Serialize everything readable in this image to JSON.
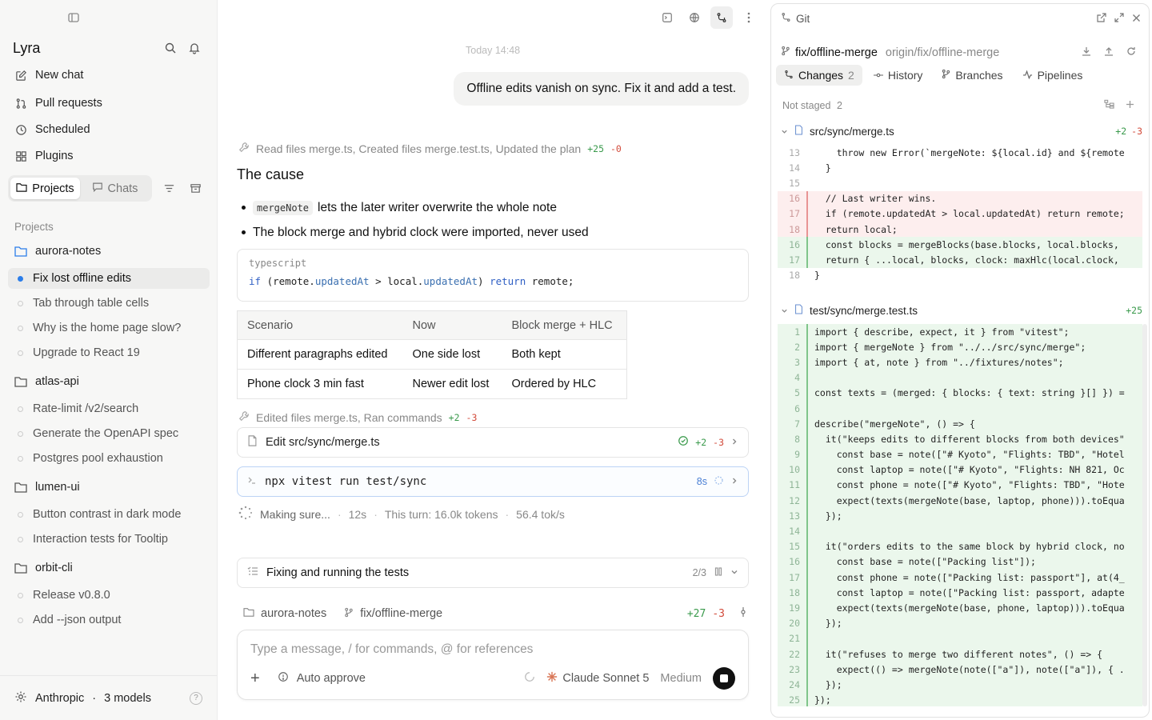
{
  "sidebar": {
    "brand": "Lyra",
    "nav": [
      {
        "label": "New chat",
        "icon": "compose-icon"
      },
      {
        "label": "Pull requests",
        "icon": "pull-request-icon"
      },
      {
        "label": "Scheduled",
        "icon": "clock-icon"
      },
      {
        "label": "Plugins",
        "icon": "plugins-icon"
      }
    ],
    "tabs": {
      "projects": "Projects",
      "chats": "Chats"
    },
    "section_label": "Projects",
    "projects": [
      {
        "name": "aurora-notes",
        "threads": [
          "Fix lost offline edits",
          "Tab through table cells",
          "Why is the home page slow?",
          "Upgrade to React 19"
        ]
      },
      {
        "name": "atlas-api",
        "threads": [
          "Rate-limit /v2/search",
          "Generate the OpenAPI spec",
          "Postgres pool exhaustion"
        ]
      },
      {
        "name": "lumen-ui",
        "threads": [
          "Button contrast in dark mode",
          "Interaction tests for Tooltip"
        ]
      },
      {
        "name": "orbit-cli",
        "threads": [
          "Release v0.8.0",
          "Add --json output"
        ]
      }
    ],
    "footer": {
      "provider": "Anthropic",
      "dot": "·",
      "models": "3 models",
      "help": "?"
    }
  },
  "chat": {
    "timestamp": "Today 14:48",
    "user_message": "Offline edits vanish on sync. Fix it and add a test.",
    "activity1": {
      "text": "Read files merge.ts, Created files merge.test.ts, Updated the plan",
      "add": "+25",
      "del": "-0"
    },
    "heading": "The cause",
    "bullet1": {
      "code": "mergeNote",
      "text": "lets the later writer overwrite the whole note"
    },
    "bullet2": "The block merge and hybrid clock were imported, never used",
    "code": {
      "lang": "typescript",
      "kw1": "if",
      "p1": "(remote.",
      "prop1": "updatedAt",
      "p2": " > local.",
      "prop2": "updatedAt",
      "p3": ") ",
      "kw2": "return",
      "p4": " remote;"
    },
    "table": {
      "headers": [
        "Scenario",
        "Now",
        "Block merge + HLC"
      ],
      "rows": [
        [
          "Different paragraphs edited",
          "One side lost",
          "Both kept"
        ],
        [
          "Phone clock 3 min fast",
          "Newer edit lost",
          "Ordered by HLC"
        ]
      ]
    },
    "activity2": {
      "text": "Edited files merge.ts, Ran commands",
      "add": "+2",
      "del": "-3"
    },
    "edit_card": {
      "label": "Edit src/sync/merge.ts",
      "add": "+2",
      "del": "-3"
    },
    "run_card": {
      "label": "npx vitest run test/sync",
      "time": "8s"
    },
    "status": {
      "label": "Making sure...",
      "elapsed": "12s",
      "turn": "This turn: 16.0k tokens",
      "rate": "56.4 tok/s",
      "sep": "·"
    },
    "plan": {
      "label": "Fixing and running the tests",
      "progress": "2/3"
    },
    "context": {
      "project": "aurora-notes",
      "branch": "fix/offline-merge",
      "add": "+27",
      "del": "-3"
    },
    "composer": {
      "placeholder": "Type a message, / for commands, @ for references",
      "auto": "Auto approve",
      "model": "Claude Sonnet 5",
      "effort": "Medium"
    }
  },
  "git": {
    "title": "Git",
    "branch": "fix/offline-merge",
    "remote": "origin/fix/offline-merge",
    "tabs": [
      {
        "label": "Changes",
        "count": "2"
      },
      {
        "label": "History",
        "count": ""
      },
      {
        "label": "Branches",
        "count": ""
      },
      {
        "label": "Pipelines",
        "count": ""
      }
    ],
    "not_staged": "Not staged",
    "not_staged_count": "2",
    "file1": {
      "path": "src/sync/merge.ts",
      "add": "+2",
      "del": "-3"
    },
    "file2": {
      "path": "test/sync/merge.test.ts",
      "add": "+25"
    },
    "diff1": [
      {
        "n": "13",
        "t": "ctx",
        "code": "    throw new Error(`mergeNote: ${local.id} and ${remote"
      },
      {
        "n": "14",
        "t": "ctx",
        "code": "  }"
      },
      {
        "n": "15",
        "t": "ctx",
        "code": ""
      },
      {
        "n": "16",
        "t": "rm",
        "code": "  // Last writer wins."
      },
      {
        "n": "17",
        "t": "rm",
        "code": "  if (remote.updatedAt > local.updatedAt) return remote;"
      },
      {
        "n": "18",
        "t": "rm",
        "code": "  return local;"
      },
      {
        "n": "16",
        "t": "ad",
        "code": "  const blocks = mergeBlocks(base.blocks, local.blocks,"
      },
      {
        "n": "17",
        "t": "ad",
        "code": "  return { ...local, blocks, clock: maxHlc(local.clock,"
      },
      {
        "n": "18",
        "t": "ctx",
        "code": "}"
      }
    ],
    "diff2": [
      {
        "n": "1",
        "t": "ad",
        "code": "import { describe, expect, it } from \"vitest\";"
      },
      {
        "n": "2",
        "t": "ad",
        "code": "import { mergeNote } from \"../../src/sync/merge\";"
      },
      {
        "n": "3",
        "t": "ad",
        "code": "import { at, note } from \"../fixtures/notes\";"
      },
      {
        "n": "4",
        "t": "ad",
        "code": ""
      },
      {
        "n": "5",
        "t": "ad",
        "code": "const texts = (merged: { blocks: { text: string }[] }) ="
      },
      {
        "n": "6",
        "t": "ad",
        "code": ""
      },
      {
        "n": "7",
        "t": "ad",
        "code": "describe(\"mergeNote\", () => {"
      },
      {
        "n": "8",
        "t": "ad",
        "code": "  it(\"keeps edits to different blocks from both devices\""
      },
      {
        "n": "9",
        "t": "ad",
        "code": "    const base = note([\"# Kyoto\", \"Flights: TBD\", \"Hotel"
      },
      {
        "n": "10",
        "t": "ad",
        "code": "    const laptop = note([\"# Kyoto\", \"Flights: NH 821, Oc"
      },
      {
        "n": "11",
        "t": "ad",
        "code": "    const phone = note([\"# Kyoto\", \"Flights: TBD\", \"Hote"
      },
      {
        "n": "12",
        "t": "ad",
        "code": "    expect(texts(mergeNote(base, laptop, phone))).toEqua"
      },
      {
        "n": "13",
        "t": "ad",
        "code": "  });"
      },
      {
        "n": "14",
        "t": "ad",
        "code": ""
      },
      {
        "n": "15",
        "t": "ad",
        "code": "  it(\"orders edits to the same block by hybrid clock, no"
      },
      {
        "n": "16",
        "t": "ad",
        "code": "    const base = note([\"Packing list\"]);"
      },
      {
        "n": "17",
        "t": "ad",
        "code": "    const phone = note([\"Packing list: passport\"], at(4_"
      },
      {
        "n": "18",
        "t": "ad",
        "code": "    const laptop = note([\"Packing list: passport, adapte"
      },
      {
        "n": "19",
        "t": "ad",
        "code": "    expect(texts(mergeNote(base, phone, laptop))).toEqua"
      },
      {
        "n": "20",
        "t": "ad",
        "code": "  });"
      },
      {
        "n": "21",
        "t": "ad",
        "code": ""
      },
      {
        "n": "22",
        "t": "ad",
        "code": "  it(\"refuses to merge two different notes\", () => {"
      },
      {
        "n": "23",
        "t": "ad",
        "code": "    expect(() => mergeNote(note([\"a\"]), note([\"a\"]), { ."
      },
      {
        "n": "24",
        "t": "ad",
        "code": "  });"
      },
      {
        "n": "25",
        "t": "ad",
        "code": "});"
      }
    ]
  }
}
